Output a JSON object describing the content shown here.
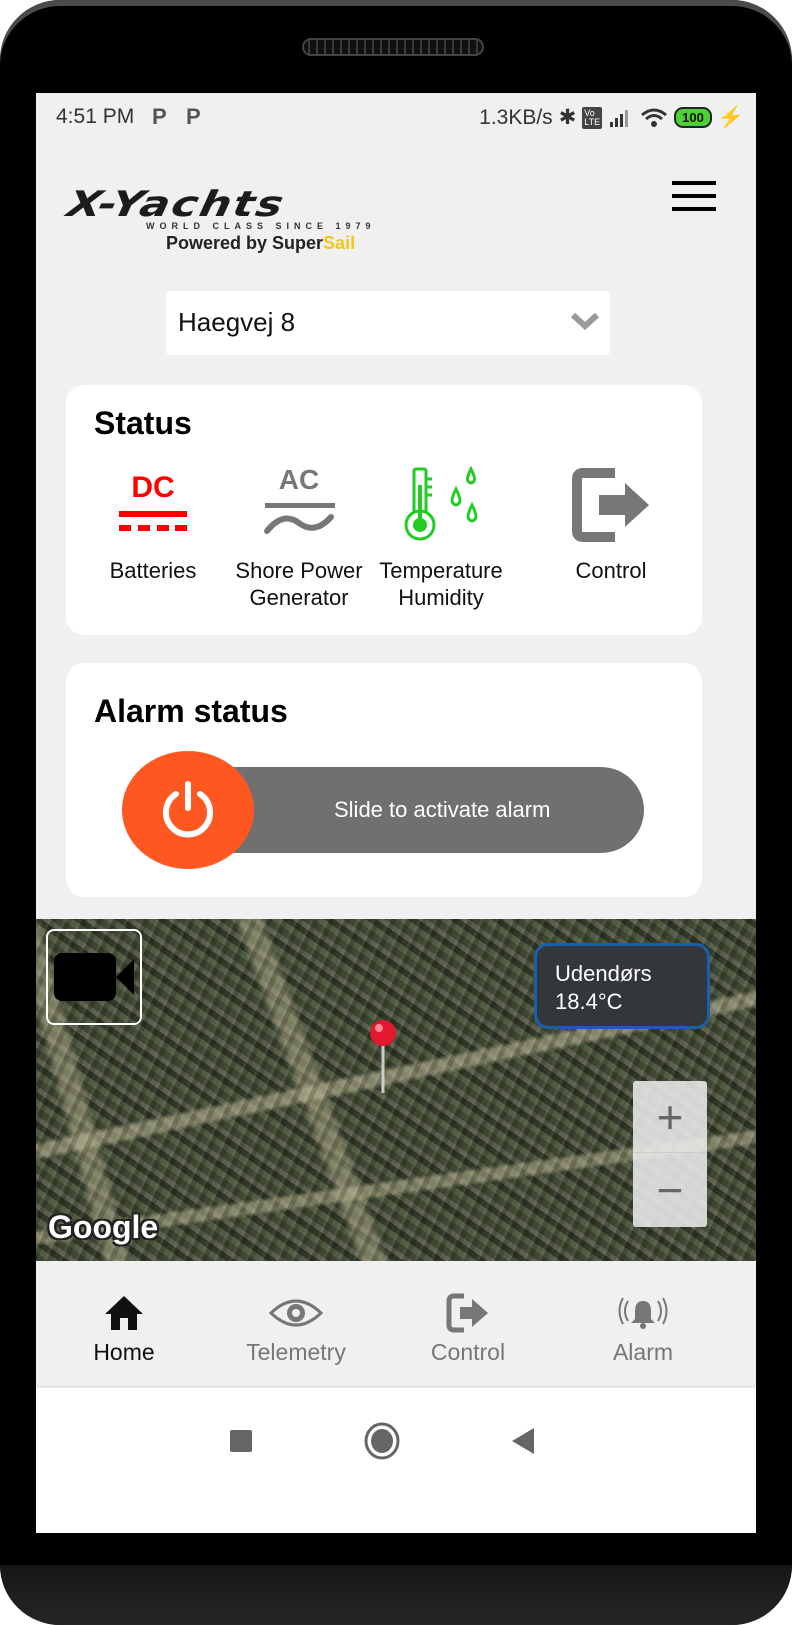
{
  "status_bar": {
    "time": "4:51 PM",
    "notif_icons": [
      "parking-app-icon",
      "parking-app-icon"
    ],
    "network_speed": "1.3KB/s",
    "volte": "Vo LTE",
    "battery_level": "100"
  },
  "header": {
    "logo_main": "X-Yachts",
    "logo_tagline": "WORLD CLASS SINCE 1979",
    "logo_powered_prefix": "Powered by Super",
    "logo_powered_suffix": "Sail",
    "menu_icon": "hamburger-menu-icon"
  },
  "location_select": {
    "value": "Haegvej 8"
  },
  "status_card": {
    "title": "Status",
    "items": [
      {
        "icon": "dc-battery-icon",
        "icon_text": "DC",
        "label_line1": "Batteries",
        "label_line2": "",
        "color": "#ff0000"
      },
      {
        "icon": "ac-power-icon",
        "icon_text": "AC",
        "label_line1": "Shore Power",
        "label_line2": "Generator",
        "color": "#777777"
      },
      {
        "icon": "thermometer-humidity-icon",
        "icon_text": "",
        "label_line1": "Temperature",
        "label_line2": "Humidity",
        "color": "#22cc22"
      },
      {
        "icon": "exit-control-icon",
        "icon_text": "",
        "label_line1": "Control",
        "label_line2": "",
        "color": "#777777"
      }
    ]
  },
  "alarm_card": {
    "title": "Alarm status",
    "slider_text": "Slide to activate alarm",
    "handle_color": "#ff5722"
  },
  "map": {
    "outdoor_label": "Udendørs",
    "outdoor_temp": "18.4°C",
    "zoom_in": "+",
    "zoom_out": "−",
    "attribution": "Google"
  },
  "bottom_nav": {
    "items": [
      {
        "label": "Home",
        "icon": "home-icon",
        "active": true
      },
      {
        "label": "Telemetry",
        "icon": "eye-icon",
        "active": false
      },
      {
        "label": "Control",
        "icon": "exit-icon",
        "active": false
      },
      {
        "label": "Alarm",
        "icon": "alarm-bell-icon",
        "active": false
      }
    ]
  }
}
